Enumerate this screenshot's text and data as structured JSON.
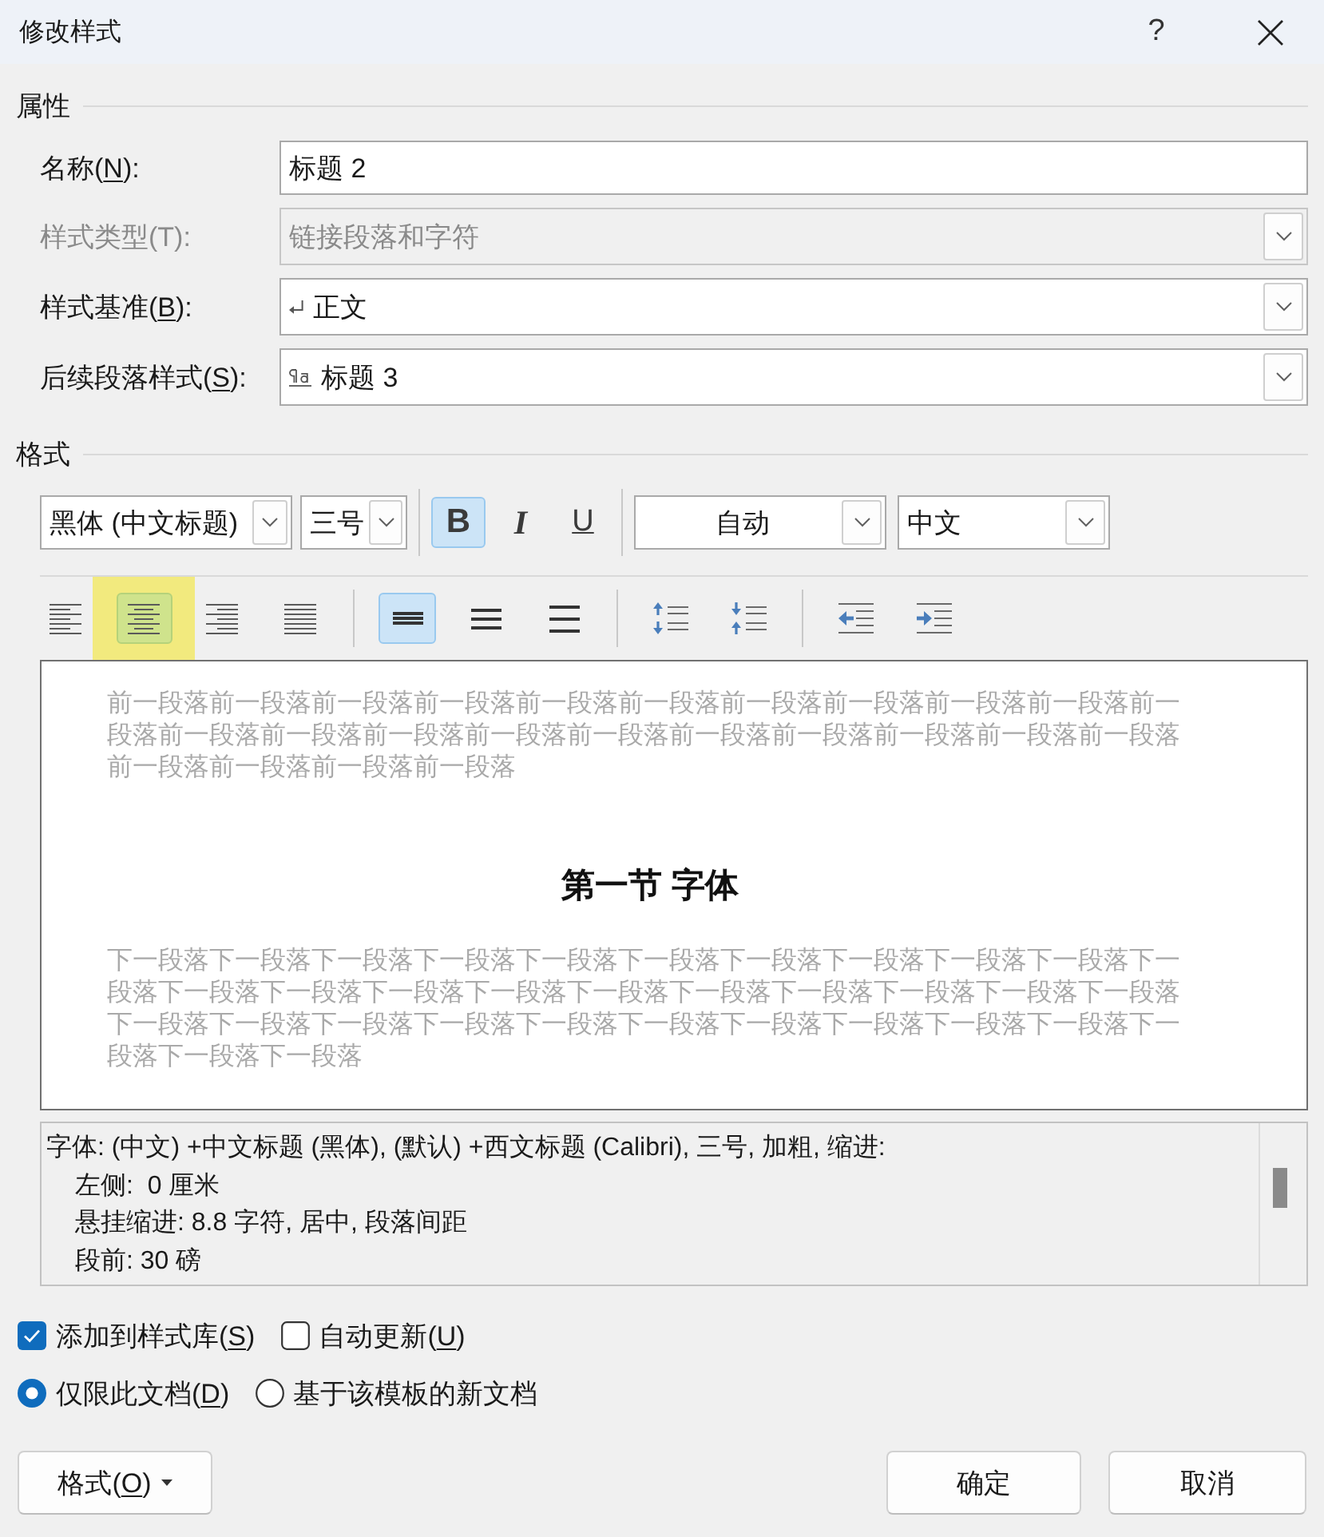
{
  "window": {
    "title": "修改样式",
    "help_button": "?"
  },
  "properties": {
    "heading": "属性",
    "fields": [
      {
        "kind": "text",
        "label": [
          {
            "text": "名称(",
            "underlined": false
          },
          {
            "text": "N",
            "underlined": true
          },
          {
            "text": "):",
            "underlined": false
          }
        ],
        "value": "标题 2",
        "disabled": false
      },
      {
        "kind": "dropdown",
        "label": [
          {
            "text": "样式类型(T):",
            "underlined": false
          }
        ],
        "value": "链接段落和字符",
        "disabled": true
      },
      {
        "kind": "dropdown",
        "label": [
          {
            "text": "样式基准(",
            "underlined": false
          },
          {
            "text": "B",
            "underlined": true
          },
          {
            "text": "):",
            "underlined": false
          }
        ],
        "value": "正文",
        "value_icon": {
          "kind": "paragraph"
        },
        "disabled": false
      },
      {
        "kind": "dropdown",
        "label": [
          {
            "text": "后续段落样式(",
            "underlined": false
          },
          {
            "text": "S",
            "underlined": true
          },
          {
            "text": "):",
            "underlined": false
          }
        ],
        "value": "标题 3",
        "value_icon": {
          "kind": "linked"
        },
        "disabled": false
      }
    ]
  },
  "format": {
    "heading": "格式",
    "font": "黑体 (中文标题)",
    "size": "三号",
    "text_styles": [
      {
        "kind": "bold",
        "label": "B",
        "selected": true
      },
      {
        "kind": "italic",
        "label": "I",
        "selected": false
      },
      {
        "kind": "underline",
        "label": "U",
        "selected": false
      }
    ],
    "font_ink": "自动",
    "language": "中文",
    "paragraph_groups": [
      {
        "tools": [
          {
            "kind": "align_left",
            "selected": false,
            "highlighted": false
          },
          {
            "kind": "align_center",
            "selected": true,
            "highlighted": true
          },
          {
            "kind": "align_right",
            "selected": false,
            "highlighted": false
          },
          {
            "kind": "justify",
            "selected": false,
            "highlighted": false
          }
        ]
      },
      {
        "tools": [
          {
            "kind": "single_spacing",
            "selected": true
          },
          {
            "kind": "one_half_spacing",
            "selected": false
          },
          {
            "kind": "double_spacing",
            "selected": false
          }
        ]
      },
      {
        "tools": [
          {
            "kind": "increase_space_before"
          },
          {
            "kind": "decrease_space_before"
          }
        ]
      },
      {
        "tools": [
          {
            "kind": "decrease_indent"
          },
          {
            "kind": "increase_indent"
          }
        ]
      }
    ]
  },
  "preview": {
    "preceding_text": "前一段落前一段落前一段落前一段落前一段落前一段落前一段落前一段落前一段落前一段落前一段落前一段落前一段落前一段落前一段落前一段落前一段落前一段落前一段落前一段落前一段落前一段落前一段落前一段落前一段落",
    "heading": "第一节 字体",
    "following_text": "下一段落下一段落下一段落下一段落下一段落下一段落下一段落下一段落下一段落下一段落下一段落下一段落下一段落下一段落下一段落下一段落下一段落下一段落下一段落下一段落下一段落下一段落下一段落下一段落下一段落下一段落下一段落下一段落下一段落下一段落下一段落下一段落下一段落下一段落"
  },
  "description": {
    "lines": [
      {
        "text": "字体: (中文) +中文标题 (黑体), (默认) +西文标题 (Calibri), 三号, 加粗, 缩进:",
        "indented": false
      },
      {
        "text": "左侧:  0 厘米",
        "indented": true
      },
      {
        "text": "悬挂缩进: 8.8 字符, 居中, 段落间距",
        "indented": true
      },
      {
        "text": "段前: 30 磅",
        "indented": true
      }
    ]
  },
  "options": {
    "checkboxes": [
      {
        "label": [
          {
            "text": "添加到样式库(",
            "underlined": false
          },
          {
            "text": "S",
            "underlined": true
          },
          {
            "text": ")",
            "underlined": false
          }
        ],
        "checked": true
      },
      {
        "label": [
          {
            "text": "自动更新(",
            "underlined": false
          },
          {
            "text": "U",
            "underlined": true
          },
          {
            "text": ")",
            "underlined": false
          }
        ],
        "checked": false
      }
    ],
    "scope": [
      {
        "label": [
          {
            "text": "仅限此文档(",
            "underlined": false
          },
          {
            "text": "D",
            "underlined": true
          },
          {
            "text": ")",
            "underlined": false
          }
        ],
        "selected": true
      },
      {
        "label": [
          {
            "text": "基于该模板的新文档",
            "underlined": false
          }
        ],
        "selected": false
      }
    ]
  },
  "buttons": {
    "format": {
      "label": [
        {
          "text": "格式(",
          "underlined": false
        },
        {
          "text": "O",
          "underlined": true
        },
        {
          "text": ")",
          "underlined": false
        }
      ]
    },
    "ok": "确定",
    "cancel": "取消"
  }
}
